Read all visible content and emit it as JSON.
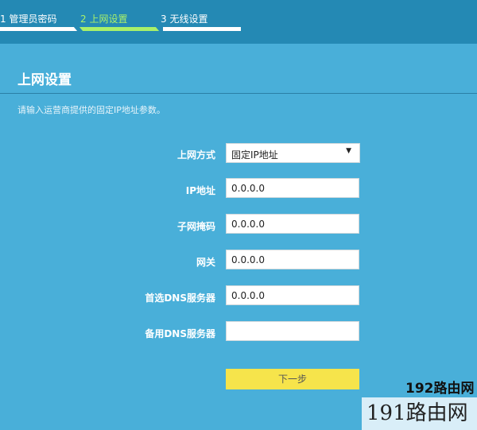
{
  "steps": [
    {
      "label": "1 管理员密码"
    },
    {
      "label": "2 上网设置"
    },
    {
      "label": "3 无线设置"
    }
  ],
  "colors": {
    "active_step": "#a8f06a",
    "button": "#f6e44b"
  },
  "title": "上网设置",
  "description": "请输入运营商提供的固定IP地址参数。",
  "form": {
    "mode_label": "上网方式",
    "mode_value": "固定IP地址",
    "ip_label": "IP地址",
    "ip_value": "0.0.0.0",
    "mask_label": "子网掩码",
    "mask_value": "0.0.0.0",
    "gw_label": "网关",
    "gw_value": "0.0.0.0",
    "dns1_label": "首选DNS服务器",
    "dns1_value": "0.0.0.0",
    "dns2_label": "备用DNS服务器",
    "dns2_value": ""
  },
  "next_label": "下一步",
  "watermark": {
    "top": "192路由网",
    "bottom": "191路由网"
  }
}
